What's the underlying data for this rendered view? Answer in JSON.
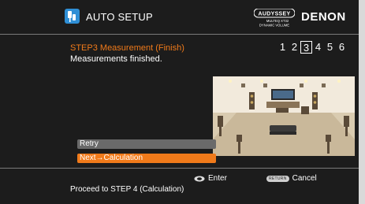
{
  "header": {
    "title": "AUTO SETUP",
    "audyssey_logo_text": "AUDYSSEY",
    "audyssey_sub1": "MULTEQ XT32",
    "audyssey_sub2": "DYNAMIC VOLUME",
    "brand": "DENON"
  },
  "step": {
    "title": "STEP3 Measurement (Finish)",
    "status": "Measurements finished.",
    "numbers": [
      "1",
      "2",
      "3",
      "4",
      "5",
      "6"
    ],
    "current": "3"
  },
  "menu": {
    "items": [
      {
        "label": "Retry",
        "selected": false
      },
      {
        "label": "Next→Calculation",
        "selected": true
      }
    ]
  },
  "footer": {
    "enter_label": "Enter",
    "return_badge": "RETURN",
    "cancel_label": "Cancel",
    "hint": "Proceed to STEP 4 (Calculation)"
  },
  "colors": {
    "accent": "#f07a1a",
    "background": "#1c1c1c",
    "icon_blue": "#2f8fd6",
    "unselected_item": "#6a6a6a"
  },
  "icons": {
    "setup_icon": "speaker-mic-icon",
    "enter_icon": "enter-button-icon"
  }
}
